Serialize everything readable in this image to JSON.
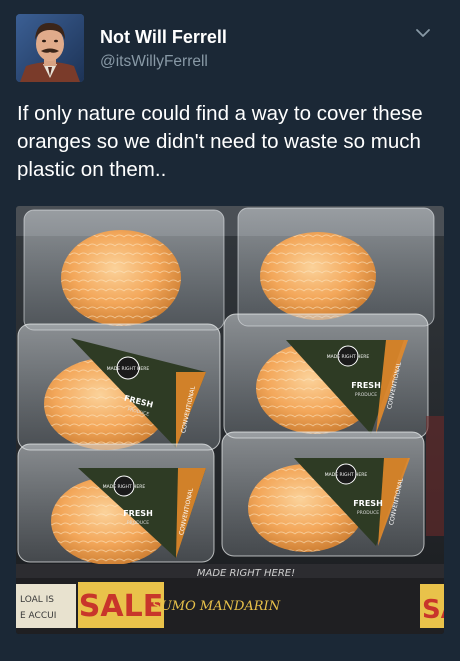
{
  "tweet": {
    "display_name": "Not Will Ferrell",
    "handle": "@itsWillyFerrell",
    "text": "If only nature could find a way to cover these oranges so we didn't need to waste so much plastic on them..",
    "menu_icon": "chevron-down-icon"
  },
  "photo": {
    "label_brand": "MADE RIGHT HERE",
    "label_fresh": "FRESH",
    "label_produce": "PRODUCE",
    "label_conventional": "CONVENTIONAL",
    "shelf_sale": "SALE",
    "shelf_sign_left_1": "LOAL IS",
    "shelf_sign_left_2": "E ACCUI",
    "shelf_sale_right": "SA",
    "shelf_handwritten": "SUMO MANDARIN",
    "shelf_top_text": "MADE RIGHT HERE!",
    "colors": {
      "label_green": "#3a4a2c",
      "label_orange": "#e38a2a",
      "orange_peel": "#f3a75a",
      "sale_yellow": "#e9c24a",
      "sale_red": "#c8352b"
    }
  }
}
